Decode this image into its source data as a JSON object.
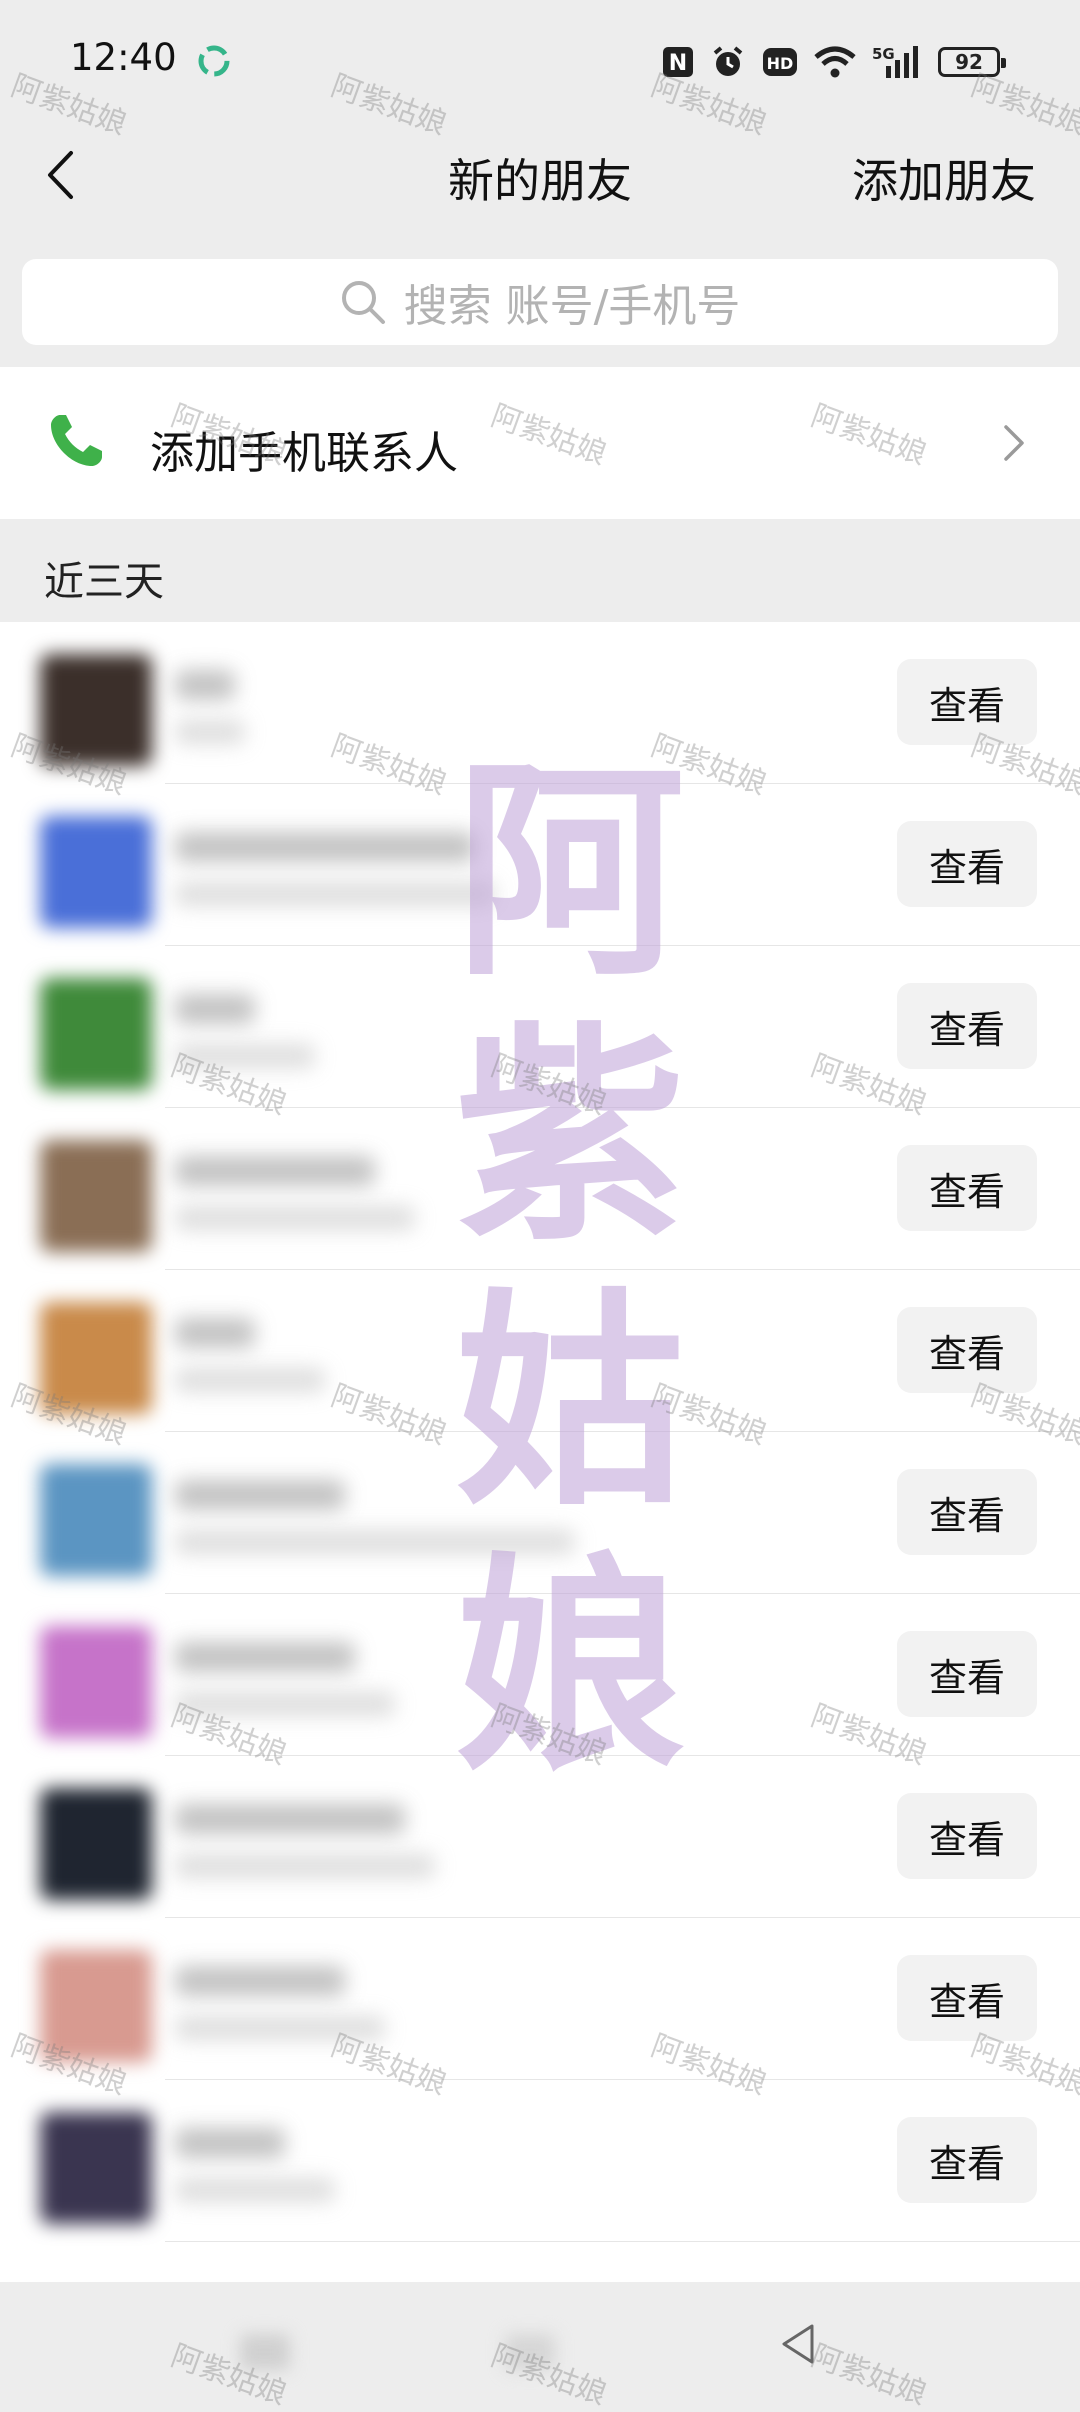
{
  "status_bar": {
    "time": "12:40",
    "battery": "92",
    "signal_label": "5G",
    "hd_label": "HD",
    "nfc_label": "N"
  },
  "header": {
    "title": "新的朋友",
    "add_friend_label": "添加朋友"
  },
  "search": {
    "placeholder": "搜索 账号/手机号"
  },
  "phone_contacts": {
    "label": "添加手机联系人"
  },
  "section": {
    "title": "近三天"
  },
  "friend_requests": [
    {
      "button": "查看",
      "avatar_color": "#3b2f2a"
    },
    {
      "button": "查看",
      "avatar_color": "#4a6fd8"
    },
    {
      "button": "查看",
      "avatar_color": "#3f8a3a"
    },
    {
      "button": "查看",
      "avatar_color": "#8a6e55"
    },
    {
      "button": "查看",
      "avatar_color": "#c98a4a"
    },
    {
      "button": "查看",
      "avatar_color": "#5b95c2"
    },
    {
      "button": "查看",
      "avatar_color": "#c673c9"
    },
    {
      "button": "查看",
      "avatar_color": "#1f2530"
    },
    {
      "button": "查看",
      "avatar_color": "#d89a90"
    },
    {
      "button": "查看",
      "avatar_color": "#3a3550"
    }
  ],
  "watermark": {
    "text": "阿紫姑娘",
    "big_chars": [
      "阿",
      "紫",
      "姑",
      "娘"
    ]
  },
  "colors": {
    "background": "#ededed",
    "phone_icon": "#3fb14a",
    "button_bg": "#f2f2f2"
  }
}
